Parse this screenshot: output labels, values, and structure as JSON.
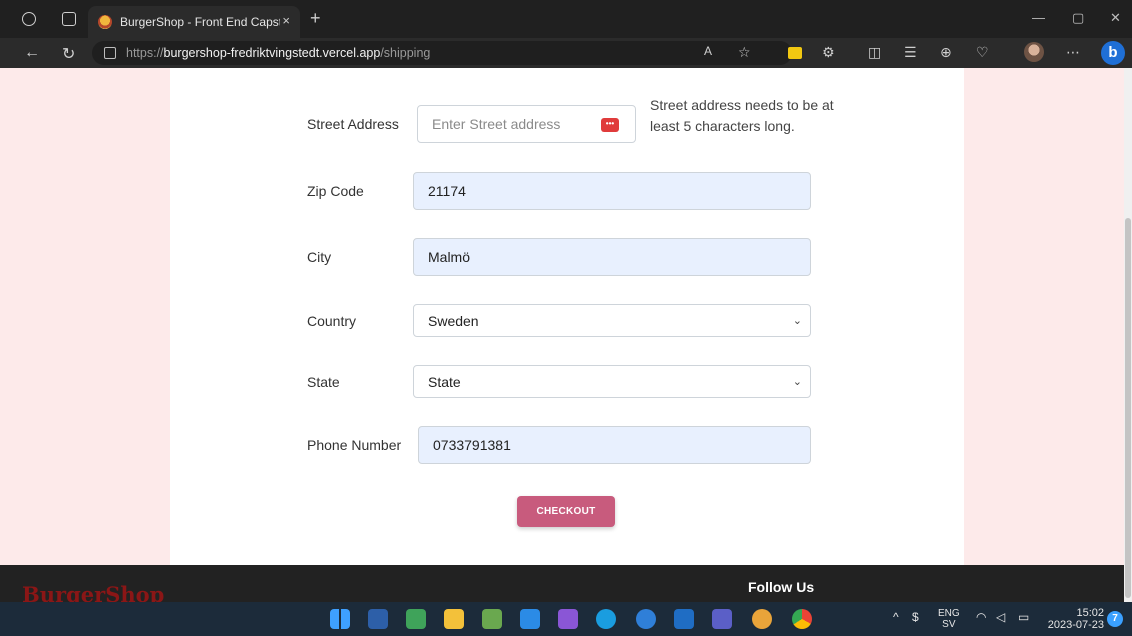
{
  "browser": {
    "tab_title": "BurgerShop - Front End Capston",
    "tab_close": "×",
    "new_tab": "+",
    "url_scheme": "https://",
    "url_host": "burgershop-fredriktvingstedt.vercel.app",
    "url_path": "/shipping"
  },
  "form": {
    "street": {
      "label": "Street Address",
      "placeholder": "Enter Street address",
      "error": "Street address needs to be at least 5 characters long."
    },
    "zip": {
      "label": "Zip Code",
      "value": "21174"
    },
    "city": {
      "label": "City",
      "value": "Malmö"
    },
    "country": {
      "label": "Country",
      "value": "Sweden"
    },
    "state": {
      "label": "State",
      "value": "State"
    },
    "phone": {
      "label": "Phone Number",
      "value": "0733791381"
    },
    "checkout_label": "CHECKOUT"
  },
  "footer": {
    "brand": "BurgerShop",
    "follow_heading": "Follow Us"
  },
  "taskbar": {
    "lang_top": "ENG",
    "lang_bottom": "SV",
    "time": "15:02",
    "date": "2023-07-23",
    "notifications": "7"
  },
  "colors": {
    "accent": "#c85b7d",
    "page_bg": "#fdeaea",
    "autofill_bg": "#e8f0fe",
    "footer_bg": "#222222",
    "brand_red": "#8b1616"
  }
}
